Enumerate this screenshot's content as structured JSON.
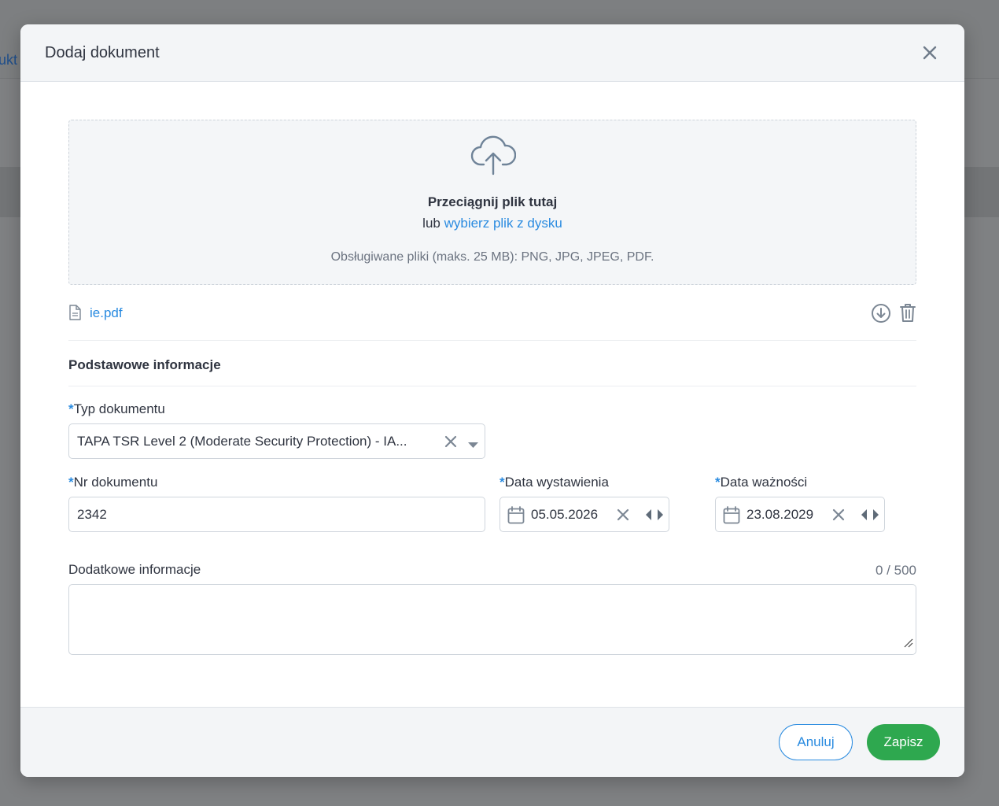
{
  "background": {
    "peek_text": "ukt"
  },
  "modal": {
    "title": "Dodaj dokument",
    "close_icon": "close-icon"
  },
  "dropzone": {
    "icon": "cloud-upload-icon",
    "title": "Przeciągnij plik tutaj",
    "or_text": "lub",
    "link_text": "wybierz plik z dysku",
    "hint": "Obsługiwane pliki (maks. 25 MB): PNG, JPG, JPEG, PDF."
  },
  "file": {
    "icon": "document-icon",
    "name": "ie.pdf",
    "download_icon": "download-icon",
    "delete_icon": "trash-icon"
  },
  "section": {
    "title": "Podstawowe informacje"
  },
  "fields": {
    "required_marker": "*",
    "doc_type": {
      "label": "Typ dokumentu",
      "value": "TAPA TSR Level 2 (Moderate Security Protection) - IA..."
    },
    "doc_number": {
      "label": "Nr dokumentu",
      "value": "2342"
    },
    "issue_date": {
      "label": "Data wystawienia",
      "value": "05.05.2026"
    },
    "expiry_date": {
      "label": "Data ważności",
      "value": "23.08.2029"
    },
    "additional": {
      "label": "Dodatkowe informacje",
      "counter": "0 / 500",
      "value": ""
    }
  },
  "footer": {
    "cancel_label": "Anuluj",
    "save_label": "Zapisz"
  },
  "colors": {
    "accent": "#2a8be0",
    "success": "#2ea84f",
    "header_bg": "#f3f5f7",
    "overlay": "#7f8183"
  }
}
